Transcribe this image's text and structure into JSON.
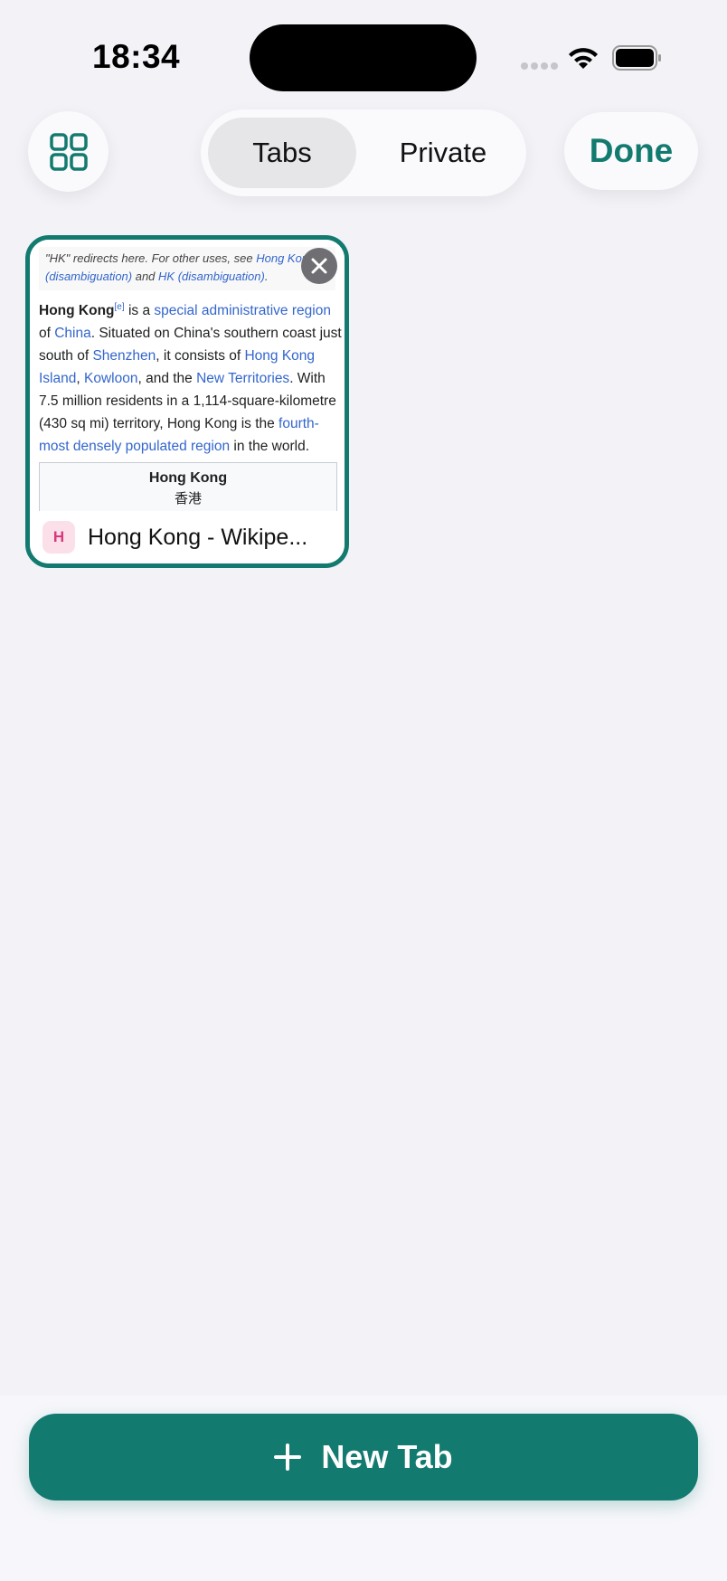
{
  "status_bar": {
    "time": "18:34",
    "icons": [
      "cellular-signal-icon",
      "wifi-icon",
      "battery-icon"
    ]
  },
  "toolbar": {
    "grid_icon": "tab-grid-icon",
    "segments": [
      {
        "label": "Tabs",
        "selected": true
      },
      {
        "label": "Private",
        "selected": false
      }
    ],
    "done_label": "Done"
  },
  "tabs": [
    {
      "title": "Hong Kong - Wikipe...",
      "favicon_letter": "H",
      "selected": true,
      "preview": {
        "hatnote": {
          "prefix": "\"HK\" redirects here. For other uses, see ",
          "link1": "Hong Kong (disambiguation)",
          "middle": " and ",
          "link2": "HK (disambiguation)",
          "suffix": "."
        },
        "article": {
          "subject": "Hong Kong",
          "footnote": "[e]",
          "t1": " is a ",
          "l1": "special administrative region",
          "t2": " of ",
          "l2": "China",
          "t3": ". Situated on China's southern coast just south of ",
          "l3": "Shenzhen",
          "t4": ", it consists of ",
          "l4": "Hong Kong Island",
          "t5": ", ",
          "l5": "Kowloon",
          "t6": ", and the ",
          "l6": "New Territories",
          "t7": ". With 7.5 million residents in a 1,114-square-kilometre (430 sq mi) territory, Hong Kong is the ",
          "l7": "fourth-most densely populated region",
          "t8": " in the world."
        },
        "infobox": {
          "title": "Hong Kong",
          "subtitle": "香港"
        }
      }
    }
  ],
  "new_tab_label": "New Tab",
  "colors": {
    "accent": "#137a6f",
    "background": "#f2f2f7",
    "link": "#3366cc"
  }
}
